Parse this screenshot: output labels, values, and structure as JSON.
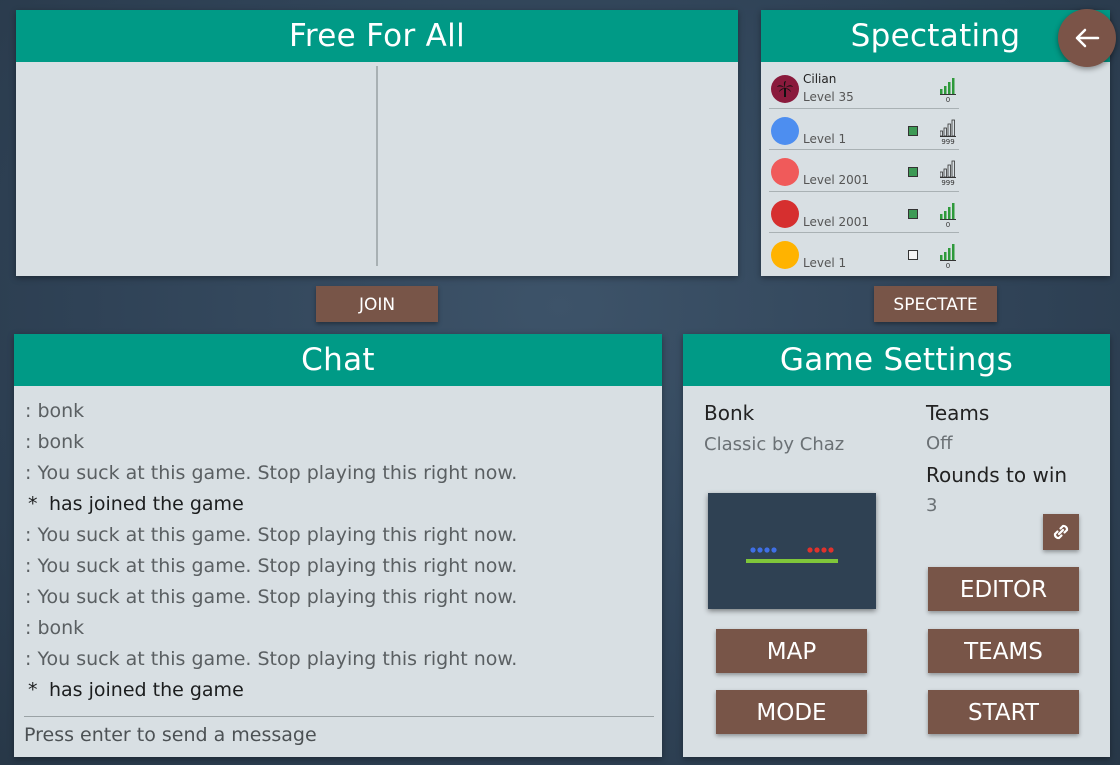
{
  "ffa": {
    "title": "Free For All"
  },
  "spectating": {
    "title": "Spectating",
    "players": [
      {
        "name": "Cilian",
        "level": "Level 35",
        "avatar_color": "#8a1a3c",
        "avatar_icon": "palm-tree-icon",
        "ready": "none",
        "ping": "0"
      },
      {
        "name": "",
        "level": "Level 1",
        "avatar_color": "#4d8ef0",
        "ready": "on",
        "ping": "999"
      },
      {
        "name": "",
        "level": "Level 2001",
        "avatar_color": "#f05a5a",
        "ready": "on",
        "ping": "999"
      },
      {
        "name": "",
        "level": "Level 2001",
        "avatar_color": "#d62f2f",
        "ready": "on",
        "ping": "0"
      },
      {
        "name": "",
        "level": "Level 1",
        "avatar_color": "#ffb300",
        "ready": "off",
        "ping": "0"
      }
    ]
  },
  "buttons": {
    "join": "JOIN",
    "spectate": "SPECTATE",
    "back_icon": "arrow-left-icon"
  },
  "chat": {
    "title": "Chat",
    "messages": [
      {
        "type": "user",
        "text": ": bonk"
      },
      {
        "type": "user",
        "text": ": bonk"
      },
      {
        "type": "user",
        "text": ": You suck at this game. Stop playing this right now."
      },
      {
        "type": "system",
        "star": "*",
        "text": "has joined the game"
      },
      {
        "type": "user",
        "text": ": You suck at this game. Stop playing this right now."
      },
      {
        "type": "user",
        "text": ": You suck at this game. Stop playing this right now."
      },
      {
        "type": "user",
        "text": ": You suck at this game. Stop playing this right now."
      },
      {
        "type": "user",
        "text": ": bonk"
      },
      {
        "type": "user",
        "text": ": You suck at this game. Stop playing this right now."
      },
      {
        "type": "system",
        "star": "*",
        "text": "has joined the game"
      }
    ],
    "input_placeholder": "Press enter to send a message"
  },
  "settings": {
    "title": "Game Settings",
    "mode_name": "Bonk",
    "map_name": "Classic by Chaz",
    "teams_label": "Teams",
    "teams_value": "Off",
    "rounds_label": "Rounds to win",
    "rounds_value": "3",
    "editor": "EDITOR",
    "map": "MAP",
    "teams": "TEAMS",
    "mode": "MODE",
    "start": "START",
    "link_icon": "link-icon"
  },
  "colors": {
    "header": "#009a86",
    "panel": "#d8dfe3",
    "button": "#785548",
    "background": "#33475b"
  }
}
